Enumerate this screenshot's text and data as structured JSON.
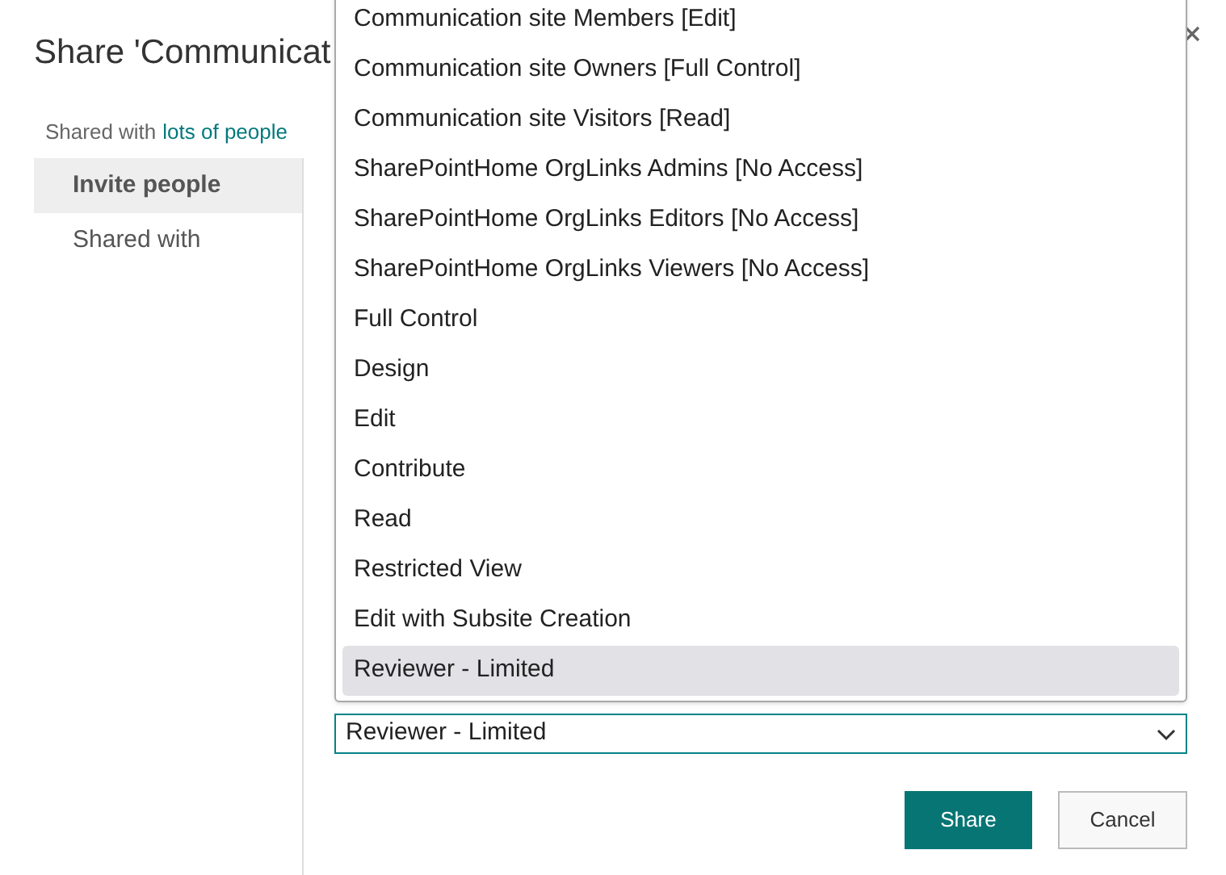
{
  "dialog": {
    "title": "Share 'Communicat",
    "shared_with": {
      "prefix": "Shared with",
      "link": "lots of people"
    },
    "nav": [
      {
        "label": "Invite people",
        "selected": true
      },
      {
        "label": "Shared with",
        "selected": false
      }
    ],
    "permission_menu": {
      "options": [
        {
          "label": "Communication site Members [Edit]",
          "selected": false
        },
        {
          "label": "Communication site Owners [Full Control]",
          "selected": false
        },
        {
          "label": "Communication site Visitors [Read]",
          "selected": false
        },
        {
          "label": "SharePointHome OrgLinks Admins [No Access]",
          "selected": false
        },
        {
          "label": "SharePointHome OrgLinks Editors [No Access]",
          "selected": false
        },
        {
          "label": "SharePointHome OrgLinks Viewers [No Access]",
          "selected": false
        },
        {
          "label": "Full Control",
          "selected": false
        },
        {
          "label": "Design",
          "selected": false
        },
        {
          "label": "Edit",
          "selected": false
        },
        {
          "label": "Contribute",
          "selected": false
        },
        {
          "label": "Read",
          "selected": false
        },
        {
          "label": "Restricted View",
          "selected": false
        },
        {
          "label": "Edit with Subsite Creation",
          "selected": false
        },
        {
          "label": "Reviewer - Limited",
          "selected": true
        }
      ]
    },
    "permission_select": {
      "value": "Reviewer - Limited"
    },
    "buttons": [
      {
        "label": "Share",
        "kind": "primary"
      },
      {
        "label": "Cancel",
        "kind": "secondary"
      }
    ]
  }
}
